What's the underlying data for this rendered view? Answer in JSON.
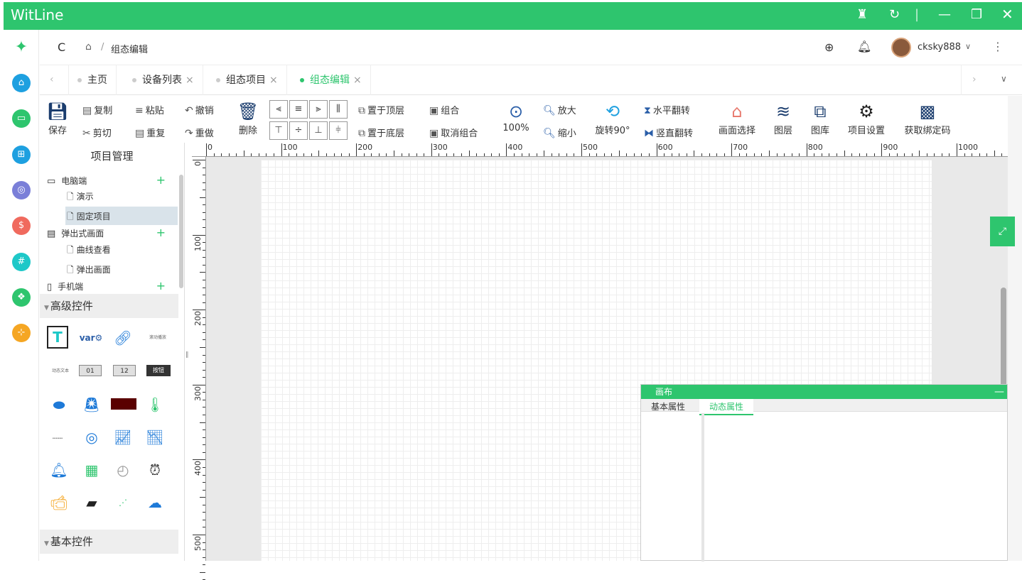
{
  "app": {
    "title": "WitLine"
  },
  "header": {
    "refresh": "C",
    "home_sep": "/",
    "breadcrumb": "组态编辑",
    "username": "cksky888",
    "user_caret": "∨",
    "more": "⋮"
  },
  "tabs": [
    {
      "label": "主页",
      "closable": false,
      "active": false
    },
    {
      "label": "设备列表",
      "closable": true,
      "active": false
    },
    {
      "label": "组态项目",
      "closable": true,
      "active": false
    },
    {
      "label": "组态编辑",
      "closable": true,
      "active": true
    }
  ],
  "tab_close": "×",
  "toolbar": {
    "save": "保存",
    "copy": "复制",
    "paste": "粘贴",
    "undo": "撤销",
    "cut": "剪切",
    "duplicate": "重复",
    "redo": "重做",
    "delete": "删除",
    "bring_top": "置于顶层",
    "send_bottom": "置于底层",
    "group": "组合",
    "ungroup": "取消组合",
    "zoom_pct": "100%",
    "zoom_in": "放大",
    "zoom_out": "缩小",
    "rotate": "旋转90°",
    "flip_h": "水平翻转",
    "flip_v": "竖直翻转",
    "screen_select": "画面选择",
    "layers": "图层",
    "library": "图库",
    "project_settings": "项目设置",
    "get_bind_code": "获取绑定码"
  },
  "panel": {
    "title": "项目管理",
    "tree": [
      {
        "label": "电脑端",
        "type": "group",
        "plus": "+"
      },
      {
        "label": "演示",
        "type": "item"
      },
      {
        "label": "固定项目",
        "type": "item",
        "selected": true
      },
      {
        "label": "弹出式画面",
        "type": "group",
        "plus": "+"
      },
      {
        "label": "曲线查看",
        "type": "item"
      },
      {
        "label": "弹出画面",
        "type": "item"
      },
      {
        "label": "手机端",
        "type": "group",
        "plus": "+"
      }
    ],
    "section_advanced": "高级控件",
    "section_basic": "基本控件",
    "mini_labels": [
      "滚动播放",
      "动态文本",
      "01",
      "12",
      "按钮"
    ]
  },
  "ruler": {
    "h": [
      "0",
      "100",
      "200",
      "300",
      "400",
      "500",
      "600",
      "700",
      "800",
      "900",
      "1000"
    ],
    "v": [
      "0",
      "100",
      "200",
      "300",
      "400",
      "500"
    ]
  },
  "props": {
    "title": "画布",
    "tab_basic": "基本属性",
    "tab_dynamic": "动态属性",
    "minimize": "—"
  },
  "colors": {
    "brand": "#2ec56e"
  }
}
